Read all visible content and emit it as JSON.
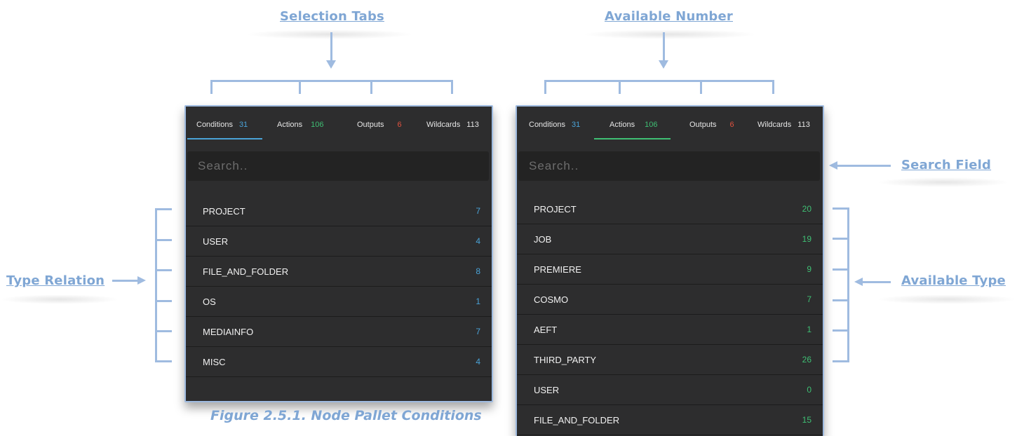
{
  "annotations": {
    "selection_tabs": "Selection Tabs",
    "available_number": "Available Number",
    "search_field": "Search Field",
    "type_relation": "Type Relation",
    "available_type": "Available Type"
  },
  "caption": "Figure 2.5.1. Node Pallet Conditions",
  "colors": {
    "conditions_accent": "#4aa3d8",
    "actions_accent": "#3fbf74",
    "outputs_accent": "#e0523f",
    "wildcards_count": "#e6e6e6",
    "panel_bg": "#2d2d2e",
    "annotation": "#7fa6d4"
  },
  "left_panel": {
    "tabs": [
      {
        "label": "Conditions",
        "count": "31"
      },
      {
        "label": "Actions",
        "count": "106"
      },
      {
        "label": "Outputs",
        "count": "6"
      },
      {
        "label": "Wildcards",
        "count": "113"
      }
    ],
    "active_tab": "Conditions",
    "search_placeholder": "Search..",
    "items": [
      {
        "name": "PROJECT",
        "count": "7"
      },
      {
        "name": "USER",
        "count": "4"
      },
      {
        "name": "FILE_AND_FOLDER",
        "count": "8"
      },
      {
        "name": "OS",
        "count": "1"
      },
      {
        "name": "MEDIAINFO",
        "count": "7"
      },
      {
        "name": "MISC",
        "count": "4"
      }
    ]
  },
  "right_panel": {
    "tabs": [
      {
        "label": "Conditions",
        "count": "31"
      },
      {
        "label": "Actions",
        "count": "106"
      },
      {
        "label": "Outputs",
        "count": "6"
      },
      {
        "label": "Wildcards",
        "count": "113"
      }
    ],
    "active_tab": "Actions",
    "search_placeholder": "Search..",
    "items": [
      {
        "name": "PROJECT",
        "count": "20"
      },
      {
        "name": "JOB",
        "count": "19"
      },
      {
        "name": "PREMIERE",
        "count": "9"
      },
      {
        "name": "COSMO",
        "count": "7"
      },
      {
        "name": "AEFT",
        "count": "1"
      },
      {
        "name": "THIRD_PARTY",
        "count": "26"
      },
      {
        "name": "USER",
        "count": "0"
      },
      {
        "name": "FILE_AND_FOLDER",
        "count": "15"
      }
    ]
  }
}
